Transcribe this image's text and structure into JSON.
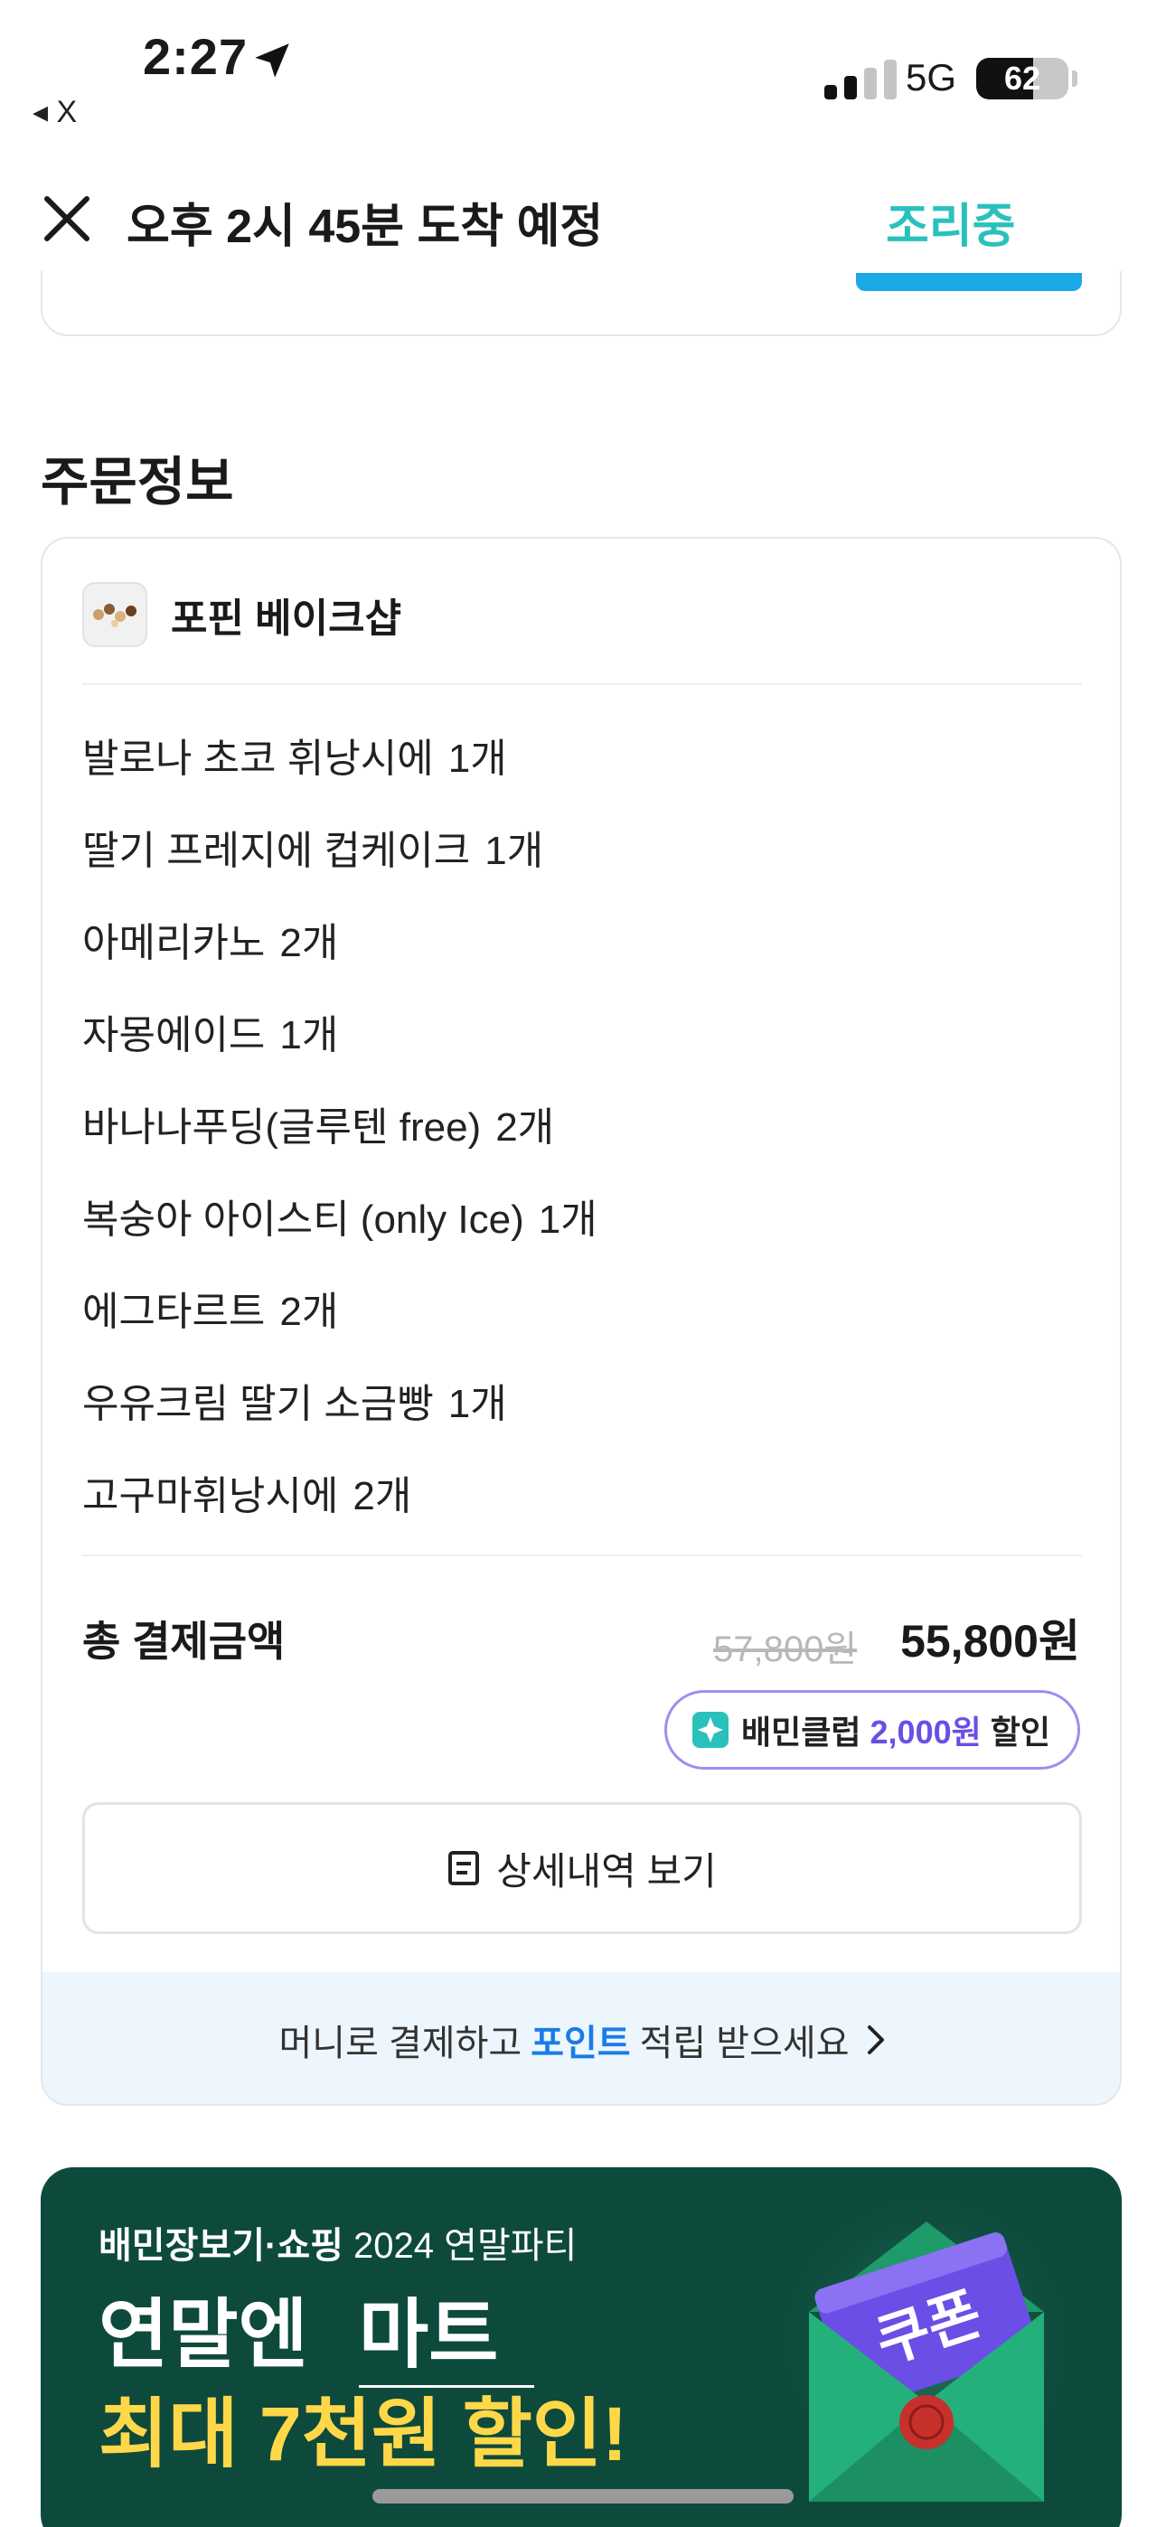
{
  "status_bar": {
    "time": "2:27",
    "back_app": "◂ X",
    "network": "5G",
    "battery": "62",
    "battery_level": 0.62
  },
  "header": {
    "title": "오후 2시 45분 도착 예정",
    "status": "조리중"
  },
  "order_info": {
    "section_title": "주문정보",
    "store_name": "포핀 베이크샵",
    "items": [
      {
        "name": "발로나 초코 휘낭시에",
        "qty": "1개"
      },
      {
        "name": "딸기 프레지에 컵케이크",
        "qty": "1개"
      },
      {
        "name": "아메리카노",
        "qty": "2개"
      },
      {
        "name": "자몽에이드",
        "qty": "1개"
      },
      {
        "name": "바나나푸딩(글루텐 free)",
        "qty": "2개"
      },
      {
        "name": "복숭아 아이스티 (only Ice)",
        "qty": "1개"
      },
      {
        "name": "에그타르트",
        "qty": "2개"
      },
      {
        "name": "우유크림 딸기 소금빵",
        "qty": "1개"
      },
      {
        "name": "고구마휘낭시에",
        "qty": "2개"
      }
    ],
    "total_label": "총 결제금액",
    "original_price": "57,800원",
    "final_price": "55,800원",
    "club_badge": {
      "prefix": "배민클럽",
      "amount": "2,000원",
      "suffix": "할인"
    },
    "detail_button": "상세내역 보기",
    "money_banner": {
      "before": "머니로 결제하고",
      "highlight": "포인트",
      "after": "적립 받으세요"
    }
  },
  "promo": {
    "brand": "배민장보기·쇼핑",
    "event": "2024 연말파티",
    "line1_a": "연말엔",
    "line1_b": "마트",
    "line2": "최대 7천원 할인!",
    "coupon_label": "쿠폰"
  },
  "colors": {
    "accent_teal": "#2ac1bc",
    "accent_blue": "#1a7ce6",
    "club_purple": "#6b4ee6",
    "promo_bg": "#0d4a3c",
    "promo_yellow": "#ffd84a"
  }
}
